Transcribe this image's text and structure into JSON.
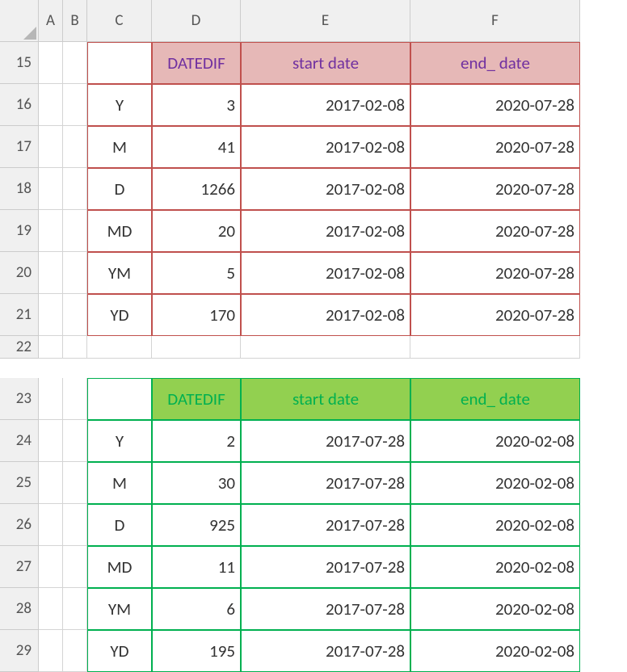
{
  "columns": [
    "A",
    "B",
    "C",
    "D",
    "E",
    "F"
  ],
  "rows": [
    "15",
    "16",
    "17",
    "18",
    "19",
    "20",
    "21",
    "22",
    "23",
    "24",
    "25",
    "26",
    "27",
    "28",
    "29"
  ],
  "block1": {
    "header": {
      "d": "DATEDIF",
      "e": "start date",
      "f": "end_ date"
    },
    "data": [
      {
        "c": "Y",
        "d": "3",
        "e": "2017-02-08",
        "f": "2020-07-28"
      },
      {
        "c": "M",
        "d": "41",
        "e": "2017-02-08",
        "f": "2020-07-28"
      },
      {
        "c": "D",
        "d": "1266",
        "e": "2017-02-08",
        "f": "2020-07-28"
      },
      {
        "c": "MD",
        "d": "20",
        "e": "2017-02-08",
        "f": "2020-07-28"
      },
      {
        "c": "YM",
        "d": "5",
        "e": "2017-02-08",
        "f": "2020-07-28"
      },
      {
        "c": "YD",
        "d": "170",
        "e": "2017-02-08",
        "f": "2020-07-28"
      }
    ]
  },
  "block2": {
    "header": {
      "d": "DATEDIF",
      "e": "start date",
      "f": "end_ date"
    },
    "data": [
      {
        "c": "Y",
        "d": "2",
        "e": "2017-07-28",
        "f": "2020-02-08"
      },
      {
        "c": "M",
        "d": "30",
        "e": "2017-07-28",
        "f": "2020-02-08"
      },
      {
        "c": "D",
        "d": "925",
        "e": "2017-07-28",
        "f": "2020-02-08"
      },
      {
        "c": "MD",
        "d": "11",
        "e": "2017-07-28",
        "f": "2020-02-08"
      },
      {
        "c": "YM",
        "d": "6",
        "e": "2017-07-28",
        "f": "2020-02-08"
      },
      {
        "c": "YD",
        "d": "195",
        "e": "2017-07-28",
        "f": "2020-02-08"
      }
    ]
  }
}
